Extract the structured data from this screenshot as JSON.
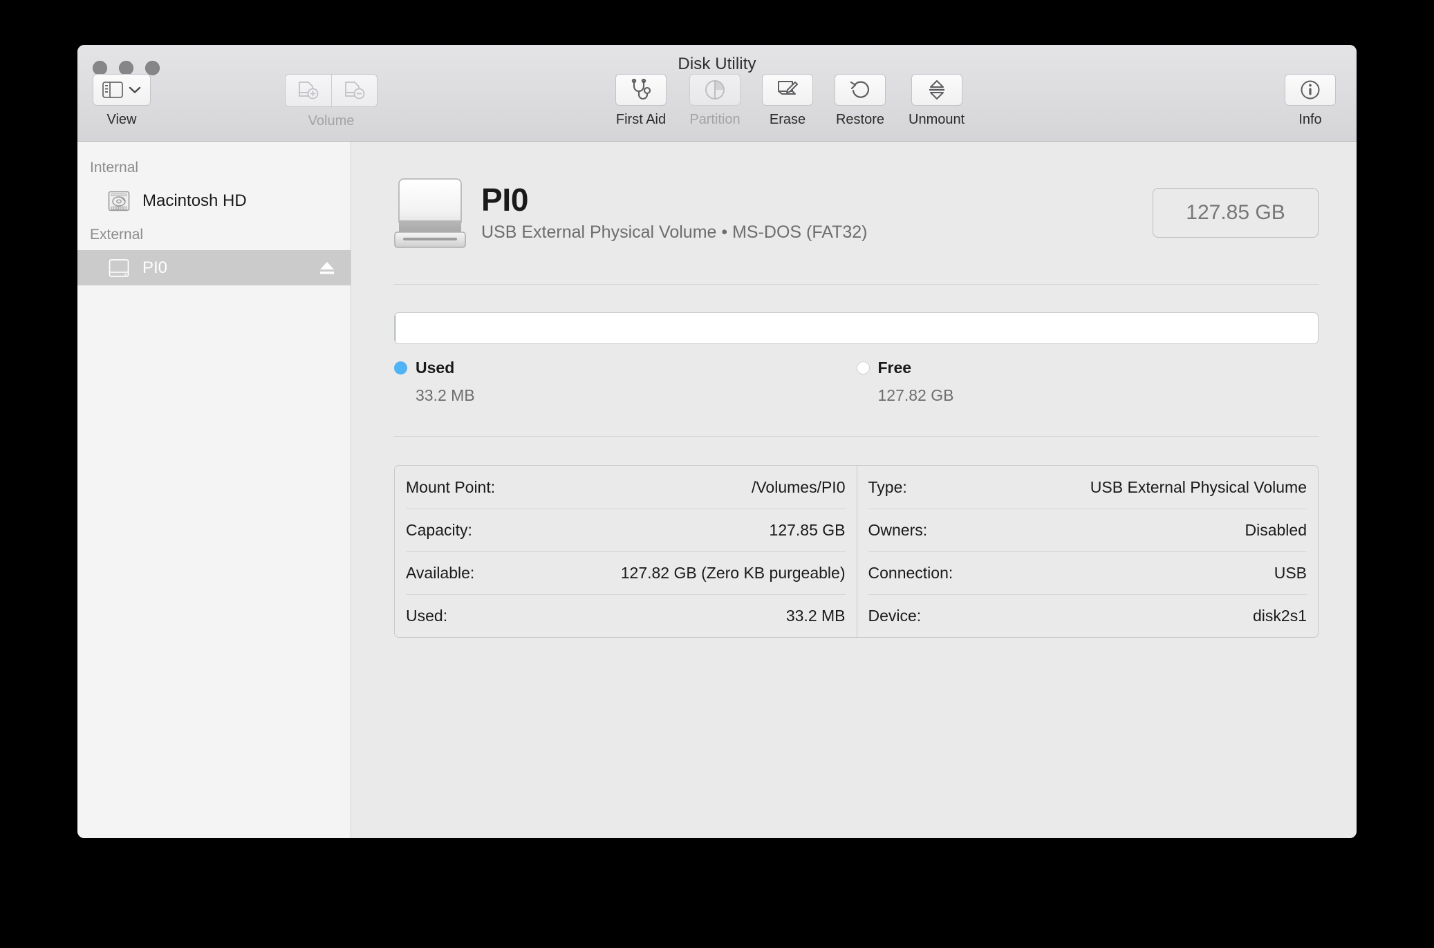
{
  "window": {
    "title": "Disk Utility",
    "traffic_lights": [
      "close",
      "minimize",
      "zoom"
    ]
  },
  "toolbar": {
    "view": {
      "label": "View",
      "icon": "sidebar-icon",
      "chevron": "chevron-down-icon",
      "enabled": true
    },
    "volume": {
      "label": "Volume",
      "enabled": false,
      "buttons": [
        {
          "name": "add-volume",
          "icon": "volume-plus-icon"
        },
        {
          "name": "remove-volume",
          "icon": "volume-minus-icon"
        }
      ]
    },
    "actions": [
      {
        "label": "First Aid",
        "icon": "stethoscope-icon",
        "enabled": true
      },
      {
        "label": "Partition",
        "icon": "pie-chart-icon",
        "enabled": false
      },
      {
        "label": "Erase",
        "icon": "erase-icon",
        "enabled": true
      },
      {
        "label": "Restore",
        "icon": "undo-arrow-icon",
        "enabled": true
      },
      {
        "label": "Unmount",
        "icon": "eject-double-arrow-icon",
        "enabled": true
      }
    ],
    "info": {
      "label": "Info",
      "icon": "info-circle-icon",
      "enabled": true
    }
  },
  "sidebar": {
    "sections": [
      {
        "header": "Internal",
        "items": [
          {
            "name": "Macintosh HD",
            "icon": "internal-hard-drive-icon",
            "selected": false,
            "eject": false
          }
        ]
      },
      {
        "header": "External",
        "items": [
          {
            "name": "PI0",
            "icon": "external-drive-icon",
            "selected": true,
            "eject": true,
            "eject_icon": "eject-icon"
          }
        ]
      }
    ]
  },
  "main": {
    "device": {
      "icon": "external-drive-large-icon",
      "name": "PI0",
      "subtitle": "USB External Physical Volume • MS-DOS (FAT32)",
      "capacity_badge": "127.85 GB"
    },
    "usage": {
      "used_percent": 0.026,
      "free_percent": 99.974,
      "legend": [
        {
          "label": "Used",
          "value": "33.2 MB",
          "color": "#4fb3f5"
        },
        {
          "label": "Free",
          "value": "127.82 GB",
          "color": "#ffffff"
        }
      ]
    },
    "info_table": {
      "left": [
        {
          "key": "Mount Point:",
          "value": "/Volumes/PI0"
        },
        {
          "key": "Capacity:",
          "value": "127.85 GB"
        },
        {
          "key": "Available:",
          "value": "127.82 GB (Zero KB purgeable)"
        },
        {
          "key": "Used:",
          "value": "33.2 MB"
        }
      ],
      "right": [
        {
          "key": "Type:",
          "value": "USB External Physical Volume"
        },
        {
          "key": "Owners:",
          "value": "Disabled"
        },
        {
          "key": "Connection:",
          "value": "USB"
        },
        {
          "key": "Device:",
          "value": "disk2s1"
        }
      ]
    }
  },
  "colors": {
    "accent_used": "#4fb3f5",
    "selection": "#cbcbcb",
    "sidebar_bg": "#f4f4f4",
    "content_bg": "#eaeaea",
    "titlebar_bg": "#dcdbde"
  }
}
